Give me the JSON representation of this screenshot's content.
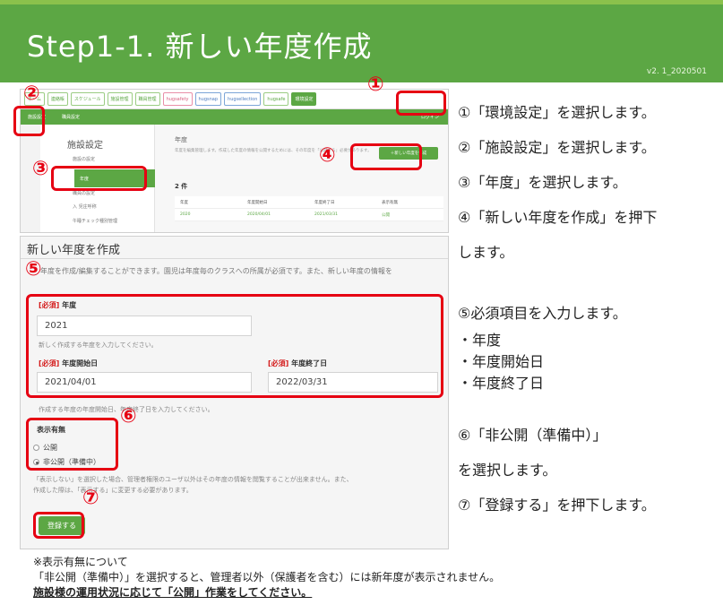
{
  "header": {
    "title": "Step1-1. 新しい年度作成",
    "version": "v2. 1_2020501"
  },
  "screenshot_top": {
    "nav_tabs": [
      "ホーム",
      "連絡帳",
      "スケジュール",
      "施設管理",
      "職員管理",
      "hugsafety",
      "hugsnap",
      "hugsellection",
      "hugsafe",
      "環境設定"
    ],
    "sub_tabs": [
      "施設設定",
      "職員設定"
    ],
    "user_label": "ログイン",
    "sidebar_title": "施設設定",
    "sidebar_items": [
      "施設の設定",
      "年度",
      "職員の設定",
      "入 児庄呼称",
      "午睡チェック種別管理"
    ],
    "content_heading": "年度",
    "content_desc": "年度を編集管理します。作成した年度の情報を公開するためには、その年度を「公開する」必要があります。",
    "new_button": "＋新しい年度を作成",
    "count": "2 件",
    "table_headers": [
      "年度",
      "年度開始日",
      "年度終了日",
      "表示有無"
    ],
    "table_row": [
      "2020",
      "2020/04/01",
      "2021/03/31",
      "公開"
    ]
  },
  "form": {
    "title": "新しい年度を作成",
    "desc": "年度を作成/編集することができます。園児は年度毎のクラスへの所属が必須です。また、新しい年度の情報を",
    "required_tag": "[必須]",
    "year_label": "年度",
    "year_value": "2021",
    "year_hint": "新しく作成する年度を入力してください。",
    "start_label": "年度開始日",
    "start_value": "2021/04/01",
    "end_label": "年度終了日",
    "end_value": "2022/03/31",
    "date_hint": "作成する年度の年度開始日、年度終了日を入力してください。",
    "visibility_label": "表示有無",
    "option_public": "公開",
    "option_private": "非公開（準備中）",
    "note_line1": "「表示しない」を選択した場合、管理者権限のユーザ以外はその年度の情報を閲覧することが出来ません。また、",
    "note_line2": "作成した際は、「表示する」に変更する必要があります。",
    "submit": "登録する"
  },
  "markers": [
    "①",
    "②",
    "③",
    "④",
    "⑤",
    "⑥",
    "⑦"
  ],
  "steps": {
    "s1": "①「環境設定」を選択します。",
    "s2": "②「施設設定」を選択します。",
    "s3": "③「年度」を選択します。",
    "s4a": "④「新しい年度を作成」を押下",
    "s4b": "します。",
    "s5": "⑤必須項目を入力します。",
    "s5i1": "・年度",
    "s5i2": "・年度開始日",
    "s5i3": "・年度終了日",
    "s6a": "⑥「非公開（準備中）」",
    "s6b": "を選択します。",
    "s7": "⑦「登録する」を押下します。"
  },
  "footer": {
    "line1": "※表示有無について",
    "line2": "「非公開（準備中）」を選択すると、管理者以外（保護者を含む）には新年度が表示されません。",
    "line3": "施設様の運用状況に応じて「公開」作業をしてください。"
  },
  "colors": {
    "brand_green": "#5ca744",
    "annotation_red": "#e60012"
  }
}
